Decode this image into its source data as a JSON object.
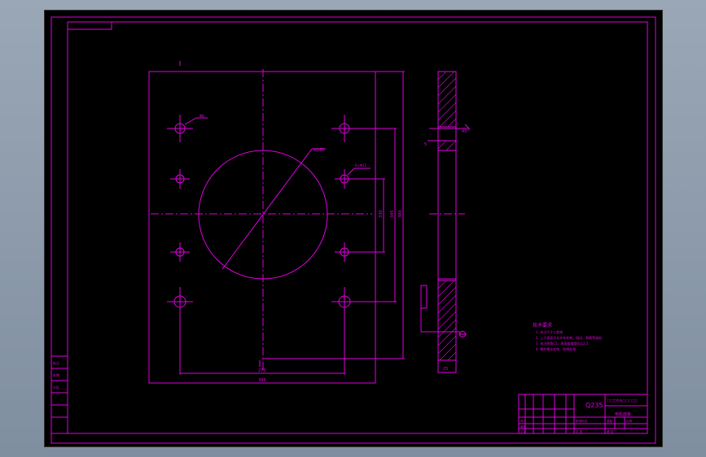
{
  "drawing": {
    "material": "Q235",
    "part_name": "电机底板",
    "project_title": "□□工作台□□□□□",
    "technical_requirements": {
      "heading": "技术要求",
      "items": [
        "1. 未注尺寸公差按",
        "2. 上下表面不允许有毛刺、锐边、划痕等缺陷",
        "3. 未注倒角C1，表面粗糙度Ra12.5",
        "4. 零件需去毛刺、防锈处理"
      ]
    },
    "dimensions": {
      "width_outer": "395",
      "width_holes": "270",
      "height_1": "330",
      "height_2": "345",
      "height_3": "380",
      "thickness": "25",
      "circle_dia": "Φ160",
      "hole_callout": "6×Φ12",
      "hole_dia_small": "Φ8",
      "side_left": "5",
      "side_angle": "45°"
    },
    "side_labels": [
      "标记",
      "处数",
      "分区"
    ],
    "title_block": {
      "row_labels": [
        "设计",
        "审核",
        "工艺",
        "标准化",
        "批准"
      ],
      "scale_labels": [
        "阶段标记",
        "重量",
        "比例"
      ],
      "sheet_info": [
        "共 张",
        "第 张"
      ]
    }
  }
}
